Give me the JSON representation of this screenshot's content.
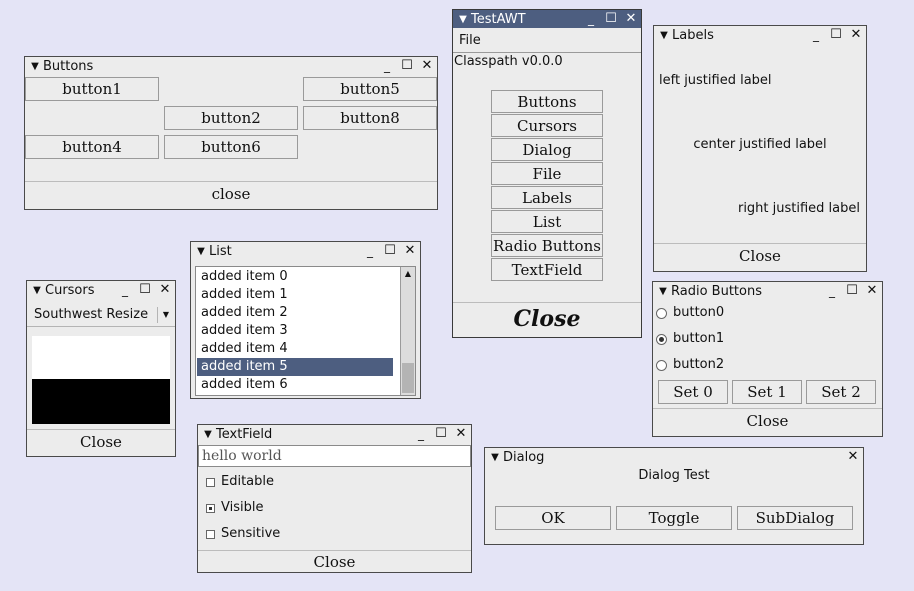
{
  "desktop": {
    "background": "#e4e4f6"
  },
  "colors": {
    "title_active": "#4d5e80",
    "selection": "#4d5e80"
  },
  "icons": {
    "menu": "triangle-down",
    "minimize": "underscore",
    "maximize": "square",
    "close": "x"
  },
  "buttons_window": {
    "title": "Buttons",
    "buttons": [
      "button1",
      "button5",
      "button2",
      "button8",
      "button4",
      "button6"
    ],
    "close": "close"
  },
  "testawt_window": {
    "title": "TestAWT",
    "menu_file": "File",
    "classpath": "Classpath v0.0.0",
    "items": [
      "Buttons",
      "Cursors",
      "Dialog",
      "File",
      "Labels",
      "List",
      "Radio Buttons",
      "TextField"
    ],
    "close": "Close"
  },
  "labels_window": {
    "title": "Labels",
    "left": "left justified label",
    "center": "center justified label",
    "right": "right justified label",
    "close": "Close"
  },
  "list_window": {
    "title": "List",
    "items": [
      "added item 0",
      "added item 1",
      "added item 2",
      "added item 3",
      "added item 4",
      "added item 5",
      "added item 6"
    ],
    "selected": "added item 5"
  },
  "cursors_window": {
    "title": "Cursors",
    "select_value": "Southwest Resize",
    "close": "Close"
  },
  "radio_window": {
    "title": "Radio Buttons",
    "options": [
      "button0",
      "button1",
      "button2"
    ],
    "selected": "button1",
    "set_buttons": [
      "Set 0",
      "Set 1",
      "Set 2"
    ],
    "close": "Close"
  },
  "textfield_window": {
    "title": "TextField",
    "value": "hello world",
    "checks": [
      {
        "label": "Editable",
        "checked": false
      },
      {
        "label": "Visible",
        "checked": true
      },
      {
        "label": "Sensitive",
        "checked": false
      }
    ],
    "close": "Close"
  },
  "dialog_window": {
    "title": "Dialog",
    "message": "Dialog Test",
    "buttons": [
      "OK",
      "Toggle",
      "SubDialog"
    ]
  }
}
